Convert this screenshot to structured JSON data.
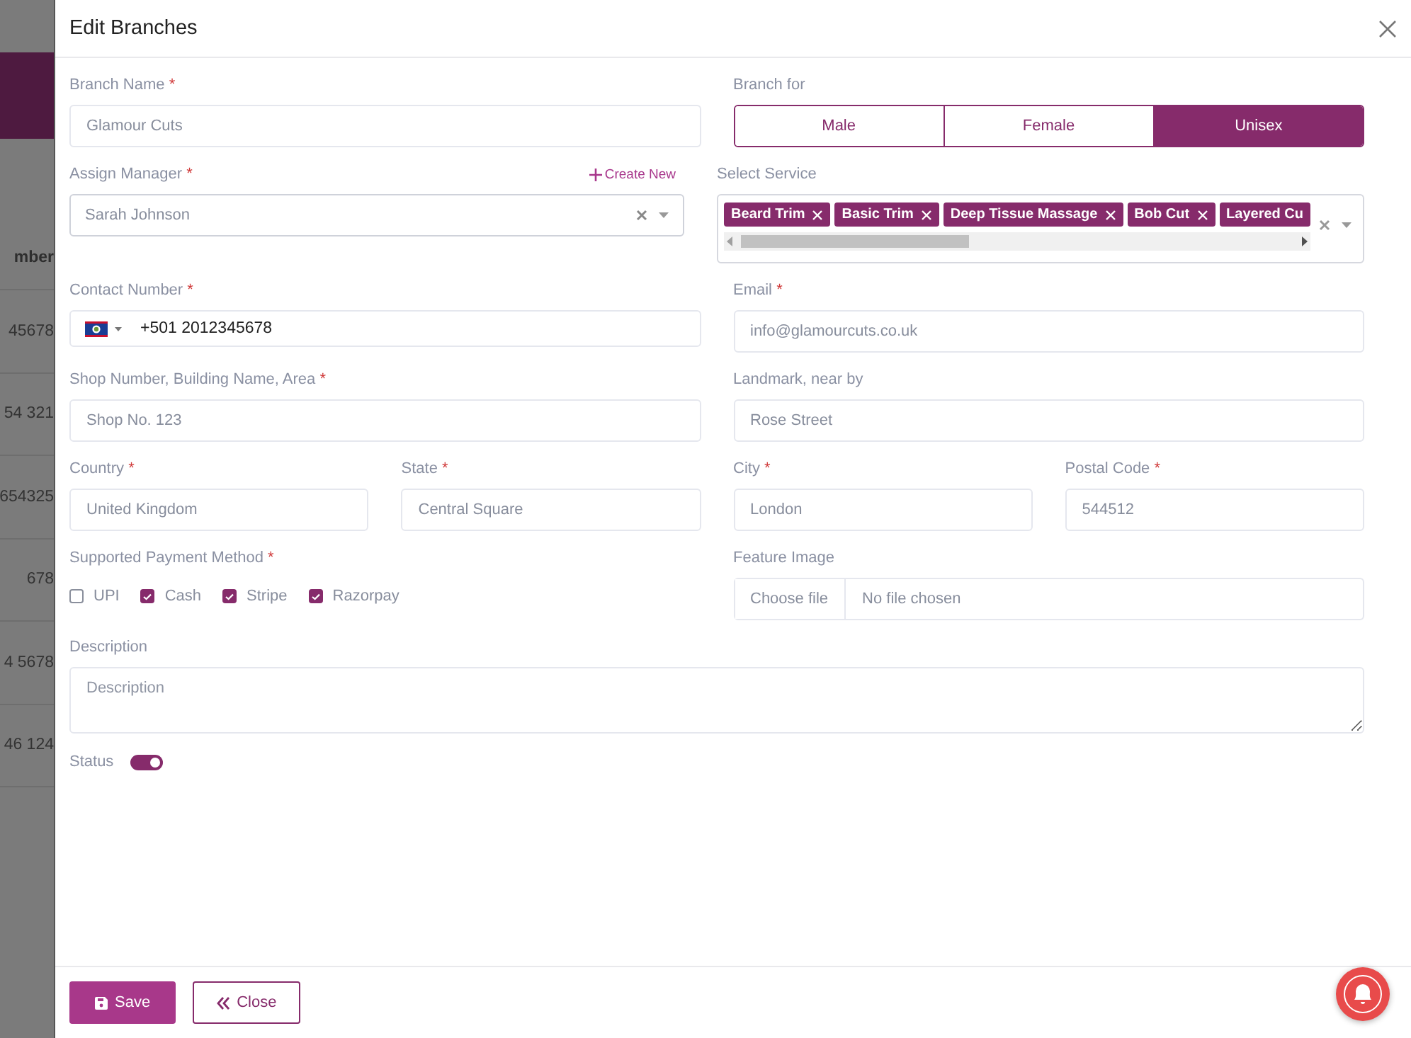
{
  "backdrop": {
    "column_header": "mber",
    "cells": [
      "45678",
      "54 321",
      "654325",
      "678",
      "4 5678",
      "46 124"
    ]
  },
  "modal": {
    "title": "Edit Branches",
    "required_mark": "*",
    "rows": [
      {
        "left": [
          {
            "kind": "text",
            "label": "Branch Name",
            "required": true,
            "value": "Glamour Cuts"
          }
        ],
        "right": [
          {
            "kind": "segmented",
            "label": "Branch for",
            "required": false,
            "options": [
              {
                "label": "Male",
                "selected": false
              },
              {
                "label": "Female",
                "selected": false
              },
              {
                "label": "Unisex",
                "selected": true
              }
            ]
          }
        ]
      },
      {
        "left": [
          {
            "kind": "select",
            "label": "Assign Manager",
            "required": true,
            "action": "Create New",
            "value": "Sarah Johnson"
          }
        ],
        "right": [
          {
            "kind": "multiselect",
            "label": "Select Service",
            "required": false,
            "tags": [
              {
                "label": "Beard Trim",
                "removable": true
              },
              {
                "label": "Basic Trim",
                "removable": true
              },
              {
                "label": "Deep Tissue Massage",
                "removable": true
              },
              {
                "label": "Bob Cut",
                "removable": true
              },
              {
                "label": "Layered Cu",
                "removable": false
              }
            ]
          }
        ]
      },
      {
        "left": [
          {
            "kind": "phone",
            "label": "Contact Number",
            "required": true,
            "value": "+501 2012345678"
          }
        ],
        "right": [
          {
            "kind": "text",
            "label": "Email",
            "required": true,
            "value": "info@glamourcuts.co.uk"
          }
        ]
      },
      {
        "left": [
          {
            "kind": "text",
            "label": "Shop Number, Building Name, Area",
            "required": true,
            "value": "Shop No. 123"
          }
        ],
        "right": [
          {
            "kind": "text",
            "label": "Landmark, near by",
            "required": false,
            "value": "Rose Street"
          }
        ]
      },
      {
        "left": [
          {
            "kind": "text",
            "label": "Country",
            "required": true,
            "value": "United Kingdom"
          },
          {
            "kind": "text",
            "label": "State",
            "required": true,
            "value": "Central Square"
          }
        ],
        "right": [
          {
            "kind": "text",
            "label": "City",
            "required": true,
            "value": "London"
          },
          {
            "kind": "text",
            "label": "Postal Code",
            "required": true,
            "value": "544512"
          }
        ]
      },
      {
        "left": [
          {
            "kind": "checkboxes",
            "label": "Supported Payment Method",
            "required": true,
            "options": [
              {
                "label": "UPI",
                "checked": false
              },
              {
                "label": "Cash",
                "checked": true
              },
              {
                "label": "Stripe",
                "checked": true
              },
              {
                "label": "Razorpay",
                "checked": true
              }
            ]
          }
        ],
        "right": [
          {
            "kind": "file",
            "label": "Feature Image",
            "required": false,
            "button": "Choose file",
            "status": "No file chosen"
          }
        ]
      }
    ],
    "description": {
      "label": "Description",
      "placeholder": "Description"
    },
    "status": {
      "label": "Status",
      "on": true
    },
    "buttons": [
      {
        "kind": "primary",
        "label": "Save"
      },
      {
        "kind": "secondary",
        "label": "Close"
      }
    ]
  }
}
